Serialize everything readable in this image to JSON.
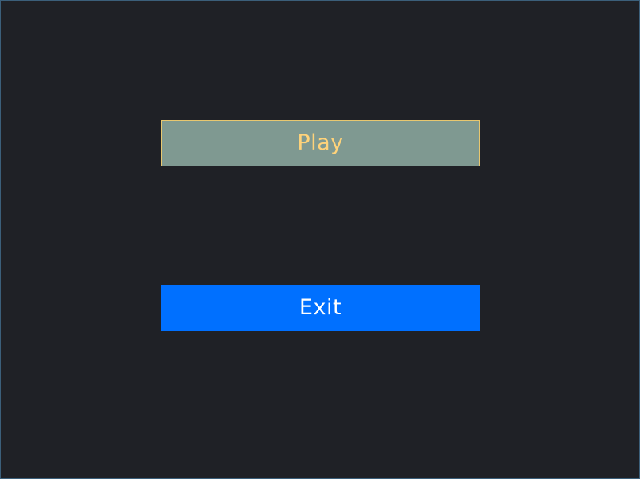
{
  "menu": {
    "play_label": "Play",
    "exit_label": "Exit"
  },
  "colors": {
    "background": "#1f2126",
    "play_fill": "#7f9991",
    "play_border": "#e8c76f",
    "play_text": "#ffd37a",
    "exit_fill": "#0070ff",
    "exit_text": "#ffffff"
  }
}
